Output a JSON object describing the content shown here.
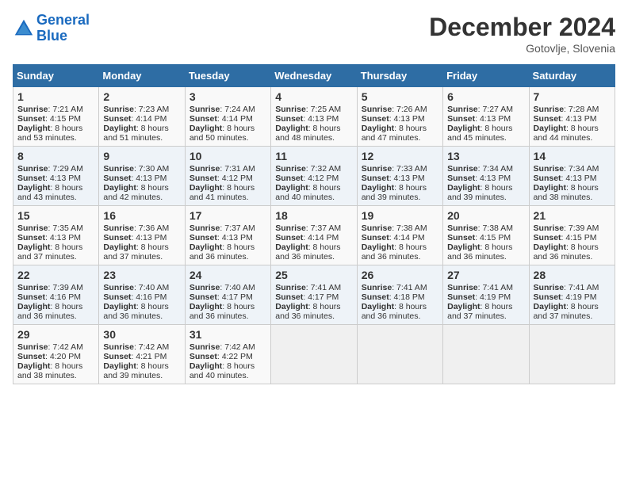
{
  "header": {
    "logo_line1": "General",
    "logo_line2": "Blue",
    "month": "December 2024",
    "location": "Gotovlje, Slovenia"
  },
  "days_of_week": [
    "Sunday",
    "Monday",
    "Tuesday",
    "Wednesday",
    "Thursday",
    "Friday",
    "Saturday"
  ],
  "weeks": [
    [
      {
        "day": "1",
        "info": "Sunrise: 7:21 AM\nSunset: 4:15 PM\nDaylight: 8 hours and 53 minutes."
      },
      {
        "day": "2",
        "info": "Sunrise: 7:23 AM\nSunset: 4:14 PM\nDaylight: 8 hours and 51 minutes."
      },
      {
        "day": "3",
        "info": "Sunrise: 7:24 AM\nSunset: 4:14 PM\nDaylight: 8 hours and 50 minutes."
      },
      {
        "day": "4",
        "info": "Sunrise: 7:25 AM\nSunset: 4:13 PM\nDaylight: 8 hours and 48 minutes."
      },
      {
        "day": "5",
        "info": "Sunrise: 7:26 AM\nSunset: 4:13 PM\nDaylight: 8 hours and 47 minutes."
      },
      {
        "day": "6",
        "info": "Sunrise: 7:27 AM\nSunset: 4:13 PM\nDaylight: 8 hours and 45 minutes."
      },
      {
        "day": "7",
        "info": "Sunrise: 7:28 AM\nSunset: 4:13 PM\nDaylight: 8 hours and 44 minutes."
      }
    ],
    [
      {
        "day": "8",
        "info": "Sunrise: 7:29 AM\nSunset: 4:13 PM\nDaylight: 8 hours and 43 minutes."
      },
      {
        "day": "9",
        "info": "Sunrise: 7:30 AM\nSunset: 4:13 PM\nDaylight: 8 hours and 42 minutes."
      },
      {
        "day": "10",
        "info": "Sunrise: 7:31 AM\nSunset: 4:12 PM\nDaylight: 8 hours and 41 minutes."
      },
      {
        "day": "11",
        "info": "Sunrise: 7:32 AM\nSunset: 4:12 PM\nDaylight: 8 hours and 40 minutes."
      },
      {
        "day": "12",
        "info": "Sunrise: 7:33 AM\nSunset: 4:13 PM\nDaylight: 8 hours and 39 minutes."
      },
      {
        "day": "13",
        "info": "Sunrise: 7:34 AM\nSunset: 4:13 PM\nDaylight: 8 hours and 39 minutes."
      },
      {
        "day": "14",
        "info": "Sunrise: 7:34 AM\nSunset: 4:13 PM\nDaylight: 8 hours and 38 minutes."
      }
    ],
    [
      {
        "day": "15",
        "info": "Sunrise: 7:35 AM\nSunset: 4:13 PM\nDaylight: 8 hours and 37 minutes."
      },
      {
        "day": "16",
        "info": "Sunrise: 7:36 AM\nSunset: 4:13 PM\nDaylight: 8 hours and 37 minutes."
      },
      {
        "day": "17",
        "info": "Sunrise: 7:37 AM\nSunset: 4:13 PM\nDaylight: 8 hours and 36 minutes."
      },
      {
        "day": "18",
        "info": "Sunrise: 7:37 AM\nSunset: 4:14 PM\nDaylight: 8 hours and 36 minutes."
      },
      {
        "day": "19",
        "info": "Sunrise: 7:38 AM\nSunset: 4:14 PM\nDaylight: 8 hours and 36 minutes."
      },
      {
        "day": "20",
        "info": "Sunrise: 7:38 AM\nSunset: 4:15 PM\nDaylight: 8 hours and 36 minutes."
      },
      {
        "day": "21",
        "info": "Sunrise: 7:39 AM\nSunset: 4:15 PM\nDaylight: 8 hours and 36 minutes."
      }
    ],
    [
      {
        "day": "22",
        "info": "Sunrise: 7:39 AM\nSunset: 4:16 PM\nDaylight: 8 hours and 36 minutes."
      },
      {
        "day": "23",
        "info": "Sunrise: 7:40 AM\nSunset: 4:16 PM\nDaylight: 8 hours and 36 minutes."
      },
      {
        "day": "24",
        "info": "Sunrise: 7:40 AM\nSunset: 4:17 PM\nDaylight: 8 hours and 36 minutes."
      },
      {
        "day": "25",
        "info": "Sunrise: 7:41 AM\nSunset: 4:17 PM\nDaylight: 8 hours and 36 minutes."
      },
      {
        "day": "26",
        "info": "Sunrise: 7:41 AM\nSunset: 4:18 PM\nDaylight: 8 hours and 36 minutes."
      },
      {
        "day": "27",
        "info": "Sunrise: 7:41 AM\nSunset: 4:19 PM\nDaylight: 8 hours and 37 minutes."
      },
      {
        "day": "28",
        "info": "Sunrise: 7:41 AM\nSunset: 4:19 PM\nDaylight: 8 hours and 37 minutes."
      }
    ],
    [
      {
        "day": "29",
        "info": "Sunrise: 7:42 AM\nSunset: 4:20 PM\nDaylight: 8 hours and 38 minutes."
      },
      {
        "day": "30",
        "info": "Sunrise: 7:42 AM\nSunset: 4:21 PM\nDaylight: 8 hours and 39 minutes."
      },
      {
        "day": "31",
        "info": "Sunrise: 7:42 AM\nSunset: 4:22 PM\nDaylight: 8 hours and 40 minutes."
      },
      {
        "day": "",
        "info": ""
      },
      {
        "day": "",
        "info": ""
      },
      {
        "day": "",
        "info": ""
      },
      {
        "day": "",
        "info": ""
      }
    ]
  ]
}
